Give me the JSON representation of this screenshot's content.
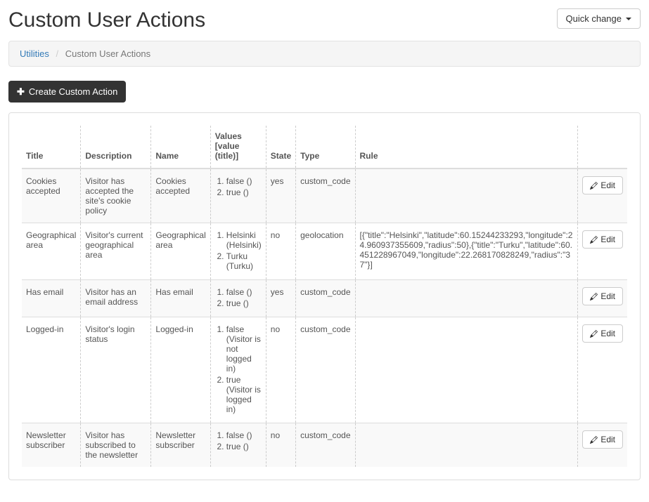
{
  "page": {
    "title": "Custom User Actions",
    "quick_change_label": "Quick change"
  },
  "breadcrumb": {
    "root": "Utilities",
    "current": "Custom User Actions"
  },
  "create_button_label": "Create Custom Action",
  "table": {
    "headers": {
      "title": "Title",
      "description": "Description",
      "name": "Name",
      "values": "Values [value (title)]",
      "state": "State",
      "type": "Type",
      "rule": "Rule"
    },
    "rows": [
      {
        "title": "Cookies accepted",
        "description": "Visitor has accepted the site's cookie policy",
        "name": "Cookies accepted",
        "values": [
          "false ()",
          "true ()"
        ],
        "state": "yes",
        "type": "custom_code",
        "rule": ""
      },
      {
        "title": "Geographical area",
        "description": "Visitor's current geographical area",
        "name": "Geographical area",
        "values": [
          "Helsinki (Helsinki)",
          "Turku (Turku)"
        ],
        "state": "no",
        "type": "geolocation",
        "rule": "[{\"title\":\"Helsinki\",\"latitude\":60.15244233293,\"longitude\":24.960937355609,\"radius\":50},{\"title\":\"Turku\",\"latitude\":60.451228967049,\"longitude\":22.268170828249,\"radius\":\"37\"}]"
      },
      {
        "title": "Has email",
        "description": "Visitor has an email address",
        "name": "Has email",
        "values": [
          "false ()",
          "true ()"
        ],
        "state": "yes",
        "type": "custom_code",
        "rule": ""
      },
      {
        "title": "Logged-in",
        "description": "Visitor's login status",
        "name": "Logged-in",
        "values": [
          "false (Visitor is not logged in)",
          "true (Visitor is logged in)"
        ],
        "state": "no",
        "type": "custom_code",
        "rule": ""
      },
      {
        "title": "Newsletter subscriber",
        "description": "Visitor has subscribed to the newsletter",
        "name": "Newsletter subscriber",
        "values": [
          "false ()",
          "true ()"
        ],
        "state": "no",
        "type": "custom_code",
        "rule": ""
      }
    ]
  },
  "edit_label": "Edit"
}
